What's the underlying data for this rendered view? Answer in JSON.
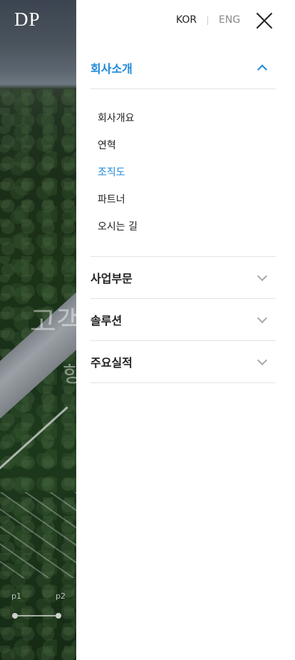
{
  "logo": "DP",
  "background": {
    "headline_1": "고객",
    "headline_2": "항",
    "pager": [
      "p1",
      "p2"
    ]
  },
  "lang": {
    "kor": "KOR",
    "eng": "ENG"
  },
  "menu": {
    "sections": [
      {
        "label": "회사소개",
        "expanded": true,
        "items": [
          "회사개요",
          "연혁",
          "조직도",
          "파트너",
          "오시는 길"
        ],
        "current_item": "조직도"
      },
      {
        "label": "사업부문",
        "expanded": false
      },
      {
        "label": "솔루션",
        "expanded": false
      },
      {
        "label": "주요실적",
        "expanded": false
      }
    ]
  },
  "colors": {
    "accent": "#1f8ad8",
    "text": "#222222",
    "divider": "#e3e3e3"
  }
}
